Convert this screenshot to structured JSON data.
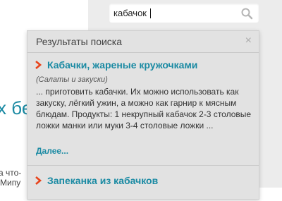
{
  "search": {
    "value": "кабачок"
  },
  "background": {
    "heading_fragment": "х бе",
    "text_line1": "а что-",
    "text_line2": "Мипу"
  },
  "popup": {
    "title": "Результаты поиска",
    "close_symbol": "×",
    "results": [
      {
        "title": "Кабачки, жареные кружочками",
        "category": "(Салаты и закуски)",
        "snippet": "... приготовить кабачки. Их можно использовать как закуску, лёгкий ужин, а можно как гарнир к мясным блюдам.   Продукты: 1 некрупный кабачок 2-3 столовые ложки манки или муки 3-4 столовые ложки ...",
        "more": "Далее..."
      },
      {
        "title": "Запеканка из кабачков"
      }
    ]
  },
  "colors": {
    "accent": "#1a8aa3",
    "arrow": "#e8431b",
    "popup_bg": "#e2e2e2",
    "panel_bg": "#ececec"
  },
  "icons": [
    "search-icon",
    "close-icon",
    "arrow-right-icon"
  ]
}
